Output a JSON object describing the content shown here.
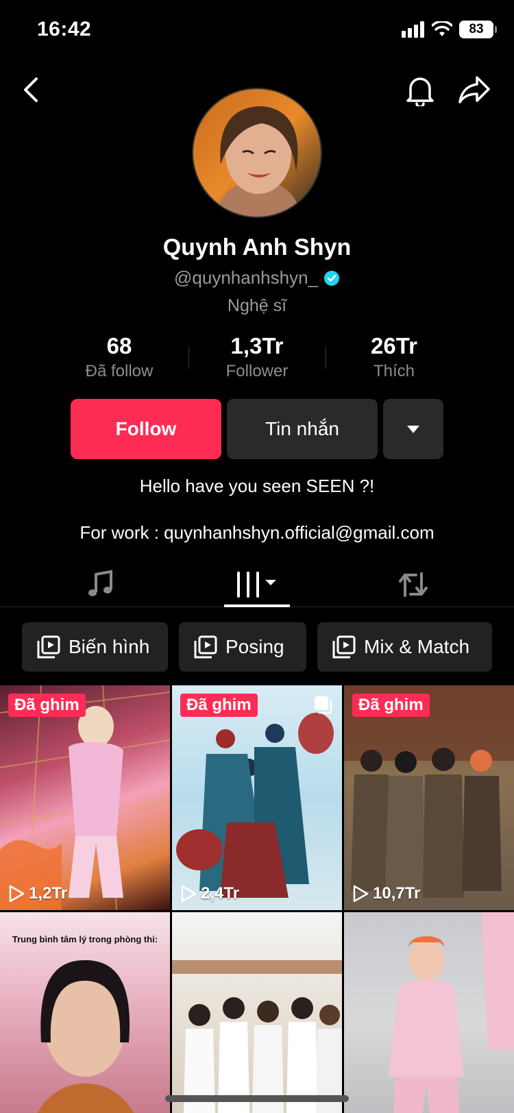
{
  "status": {
    "time": "16:42",
    "battery": "83"
  },
  "profile": {
    "name": "Quynh Anh Shyn",
    "handle": "@quynhanhshyn_",
    "role": "Nghệ sĩ",
    "stats": [
      {
        "num": "68",
        "label": "Đã follow"
      },
      {
        "num": "1,3Tr",
        "label": "Follower"
      },
      {
        "num": "26Tr",
        "label": "Thích"
      }
    ],
    "buttons": {
      "follow": "Follow",
      "message": "Tin nhắn"
    },
    "bio_line1": "Hello have you seen SEEN ?!",
    "bio_line2": "For work : quynhanhshyn.official@gmail.com"
  },
  "tabs": [
    "music",
    "videos",
    "reposts"
  ],
  "chips": [
    "Biến hình",
    "Posing",
    "Mix & Match"
  ],
  "colors": {
    "accent": "#fe2c55",
    "verified": "#20d5ec"
  },
  "videos": [
    {
      "pinned": "Đã ghim",
      "views": "1,2Tr"
    },
    {
      "pinned": "Đã ghim",
      "views": "2,4Tr"
    },
    {
      "pinned": "Đã ghim",
      "views": "10,7Tr"
    },
    {
      "caption": "Trung bình tâm lý trong phòng thi:"
    },
    {},
    {}
  ]
}
